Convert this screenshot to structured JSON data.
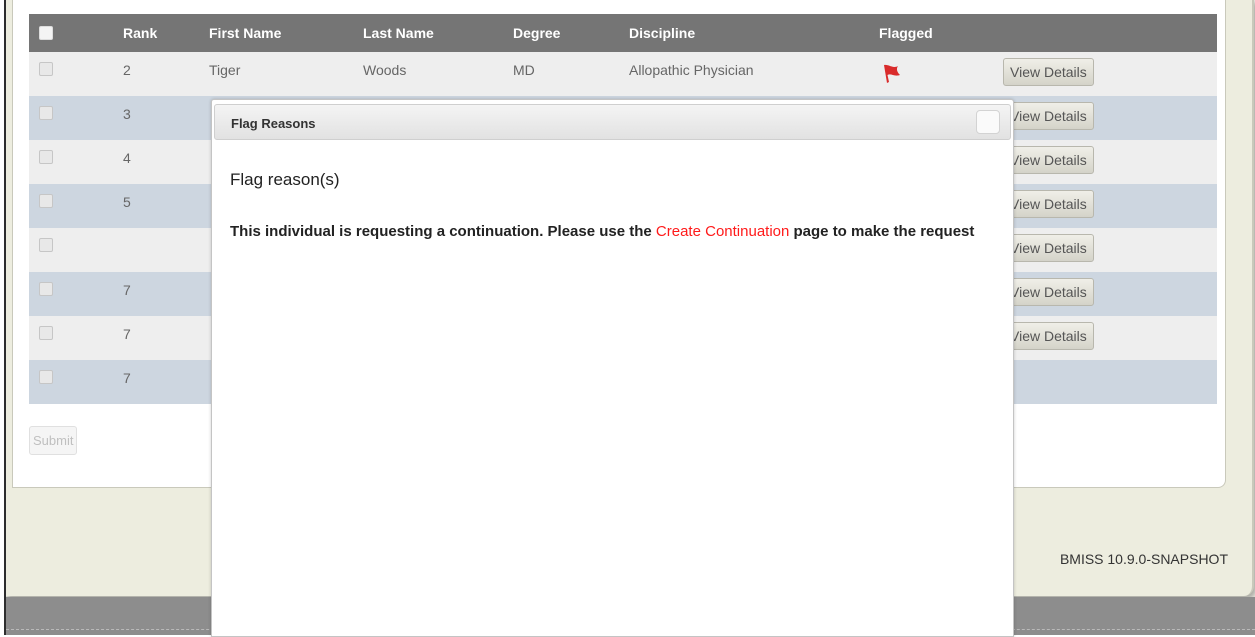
{
  "table": {
    "headers": {
      "rank": "Rank",
      "first_name": "First Name",
      "last_name": "Last Name",
      "degree": "Degree",
      "discipline": "Discipline",
      "flagged": "Flagged"
    },
    "rows": [
      {
        "rank": "2",
        "first_name": "Tiger",
        "last_name": "Woods",
        "degree": "MD",
        "discipline": "Allopathic Physician",
        "flagged": true,
        "action": "View Details"
      },
      {
        "rank": "3",
        "action": "View Details"
      },
      {
        "rank": "4",
        "action": "View Details"
      },
      {
        "rank": "5",
        "action": "View Details"
      },
      {
        "rank": "",
        "action": "View Details"
      },
      {
        "rank": "7",
        "action": "View Details"
      },
      {
        "rank": "7",
        "action": "View Details"
      },
      {
        "rank": "7",
        "action": ""
      }
    ]
  },
  "submit_label": "Submit",
  "version": "BMISS 10.9.0-SNAPSHOT",
  "modal": {
    "title": "Flag Reasons",
    "heading": "Flag reason(s)",
    "body_before": "This individual is requesting a continuation. Please use the ",
    "link_text": "Create Continuation",
    "body_after": " page to make the request"
  },
  "colors": {
    "header_bg": "#757575",
    "row_odd": "#eeeeee",
    "row_even": "#cdd6e0",
    "link": "#ff1a1a",
    "flag": "#d92b2b"
  },
  "icons": {
    "flag": "flag-icon",
    "close": "close-icon"
  }
}
